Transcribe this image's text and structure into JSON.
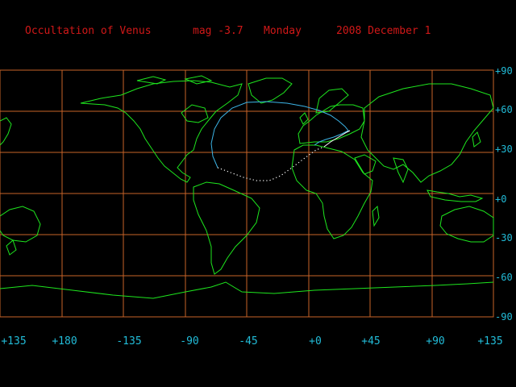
{
  "title": {
    "event": "Occultation of Venus",
    "magnitude": "mag -3.7",
    "weekday": "Monday",
    "date": "2008 December 1"
  },
  "colors": {
    "background": "#000000",
    "title": "#d01818",
    "axis_labels": "#22bcd8",
    "grid": "#c86428",
    "land": "#1ee61e",
    "visibility_curve": "#3cb4e6",
    "track": "#ffffff"
  },
  "lat_labels": [
    "+90",
    "+60",
    "+30",
    "+0",
    "-30",
    "-60",
    "-90"
  ],
  "lon_labels": [
    "+135",
    "+180",
    "-135",
    "-90",
    "-45",
    "+0",
    "+45",
    "+90",
    "+135"
  ]
}
